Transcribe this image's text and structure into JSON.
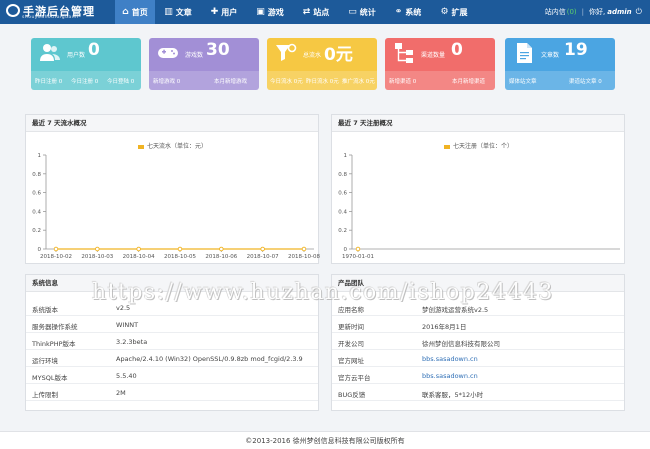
{
  "header": {
    "logo_title": "手游后台管理",
    "logo_sub": "shouyouhoutaiguanli",
    "nav": [
      {
        "icon": "⌂",
        "label": "首页",
        "active": true
      },
      {
        "icon": "▥",
        "label": "文章"
      },
      {
        "icon": "✚",
        "label": "用户"
      },
      {
        "icon": "▣",
        "label": "游戏"
      },
      {
        "icon": "⇄",
        "label": "站点"
      },
      {
        "icon": "▭",
        "label": "统计"
      },
      {
        "icon": "⚭",
        "label": "系统"
      },
      {
        "icon": "⚙",
        "label": "扩展"
      }
    ],
    "msg_label": "站内信",
    "msg_count": "(0)",
    "greeting": "你好,",
    "username": "admin",
    "logout_icon": "⏻"
  },
  "colors": {
    "header_bg": "#1d5a9a",
    "nav_active": "#3f80c6",
    "card_users": "#5ec7cf",
    "card_games": "#a28fd6",
    "card_water": "#f6c843",
    "card_channels": "#f16d6b",
    "card_articles": "#4ba5e2",
    "chart_line": "#f0b323"
  },
  "cards": [
    {
      "icon": "users-icon",
      "label": "用户数",
      "value": "0",
      "foot_left": "昨日注册 0",
      "foot_mid": "今日注册 0",
      "foot_right": "今日登陆 0"
    },
    {
      "icon": "gamepad-icon",
      "label": "游戏数",
      "value": "30",
      "foot_left": "新增游戏 0",
      "foot_right": "本月新增游戏"
    },
    {
      "icon": "funnel-icon",
      "label": "总流水",
      "value": "0元",
      "foot_left": "今日流水 0元",
      "foot_mid": "昨日流水 0元",
      "foot_right": "推广流水 0元"
    },
    {
      "icon": "sitemap-icon",
      "label": "渠道数量",
      "value": "0",
      "foot_left": "新增渠道 0",
      "foot_right": "本月新增渠道"
    },
    {
      "icon": "document-icon",
      "label": "文章数",
      "value": "19",
      "foot_left": "媒体站文章",
      "foot_right": "渠道站文章 0"
    }
  ],
  "charts": {
    "water": {
      "title": "最近 7 天流水概况",
      "legend": "七天流水（单位：元）",
      "y_ticks": [
        "1",
        "0.8",
        "0.6",
        "0.4",
        "0.2",
        "0"
      ]
    },
    "register": {
      "title": "最近 7 天注册概况",
      "legend": "七天注册（单位：个）",
      "y_ticks": [
        "1",
        "0.8",
        "0.6",
        "0.4",
        "0.2",
        "0"
      ]
    }
  },
  "chart_data": [
    {
      "type": "line",
      "x": [
        "2018-10-02",
        "2018-10-03",
        "2018-10-04",
        "2018-10-05",
        "2018-10-06",
        "2018-10-07",
        "2018-10-08"
      ],
      "series": [
        {
          "name": "七天流水（单位：元）",
          "values": [
            0,
            0,
            0,
            0,
            0,
            0,
            0
          ]
        }
      ],
      "title": "最近 7 天流水概况",
      "ylim": [
        0,
        1
      ]
    },
    {
      "type": "line",
      "x": [
        "1970-01-01"
      ],
      "series": [
        {
          "name": "七天注册（单位：个）",
          "values": [
            0
          ]
        }
      ],
      "title": "最近 7 天注册概况",
      "ylim": [
        0,
        1
      ]
    }
  ],
  "system_info": {
    "title": "系统信息",
    "rows": [
      {
        "k": "系统版本",
        "v": "v2.5"
      },
      {
        "k": "服务器操作系统",
        "v": "WINNT"
      },
      {
        "k": "ThinkPHP版本",
        "v": "3.2.3beta"
      },
      {
        "k": "运行环境",
        "v": "Apache/2.4.10 (Win32) OpenSSL/0.9.8zb mod_fcgid/2.3.9"
      },
      {
        "k": "MYSQL版本",
        "v": "5.5.40"
      },
      {
        "k": "上传限制",
        "v": "2M"
      }
    ]
  },
  "product_team": {
    "title": "产品团队",
    "rows": [
      {
        "k": "应用名称",
        "v": "梦创游戏运营系统v2.5",
        "link": false
      },
      {
        "k": "更新时间",
        "v": "2016年8月1日",
        "link": false
      },
      {
        "k": "开发公司",
        "v": "徐州梦创信息科技有限公司",
        "link": false
      },
      {
        "k": "官方网址",
        "v": "bbs.sasadown.cn",
        "link": true
      },
      {
        "k": "官方云平台",
        "v": "bbs.sasadown.cn",
        "link": true
      },
      {
        "k": "BUG反馈",
        "v": "联系客服，5*12小时",
        "link": false
      }
    ]
  },
  "footer": "©2013-2016 徐州梦创信息科技有限公司版权所有",
  "watermark": "https://www.huzhan.com/ishop24443"
}
